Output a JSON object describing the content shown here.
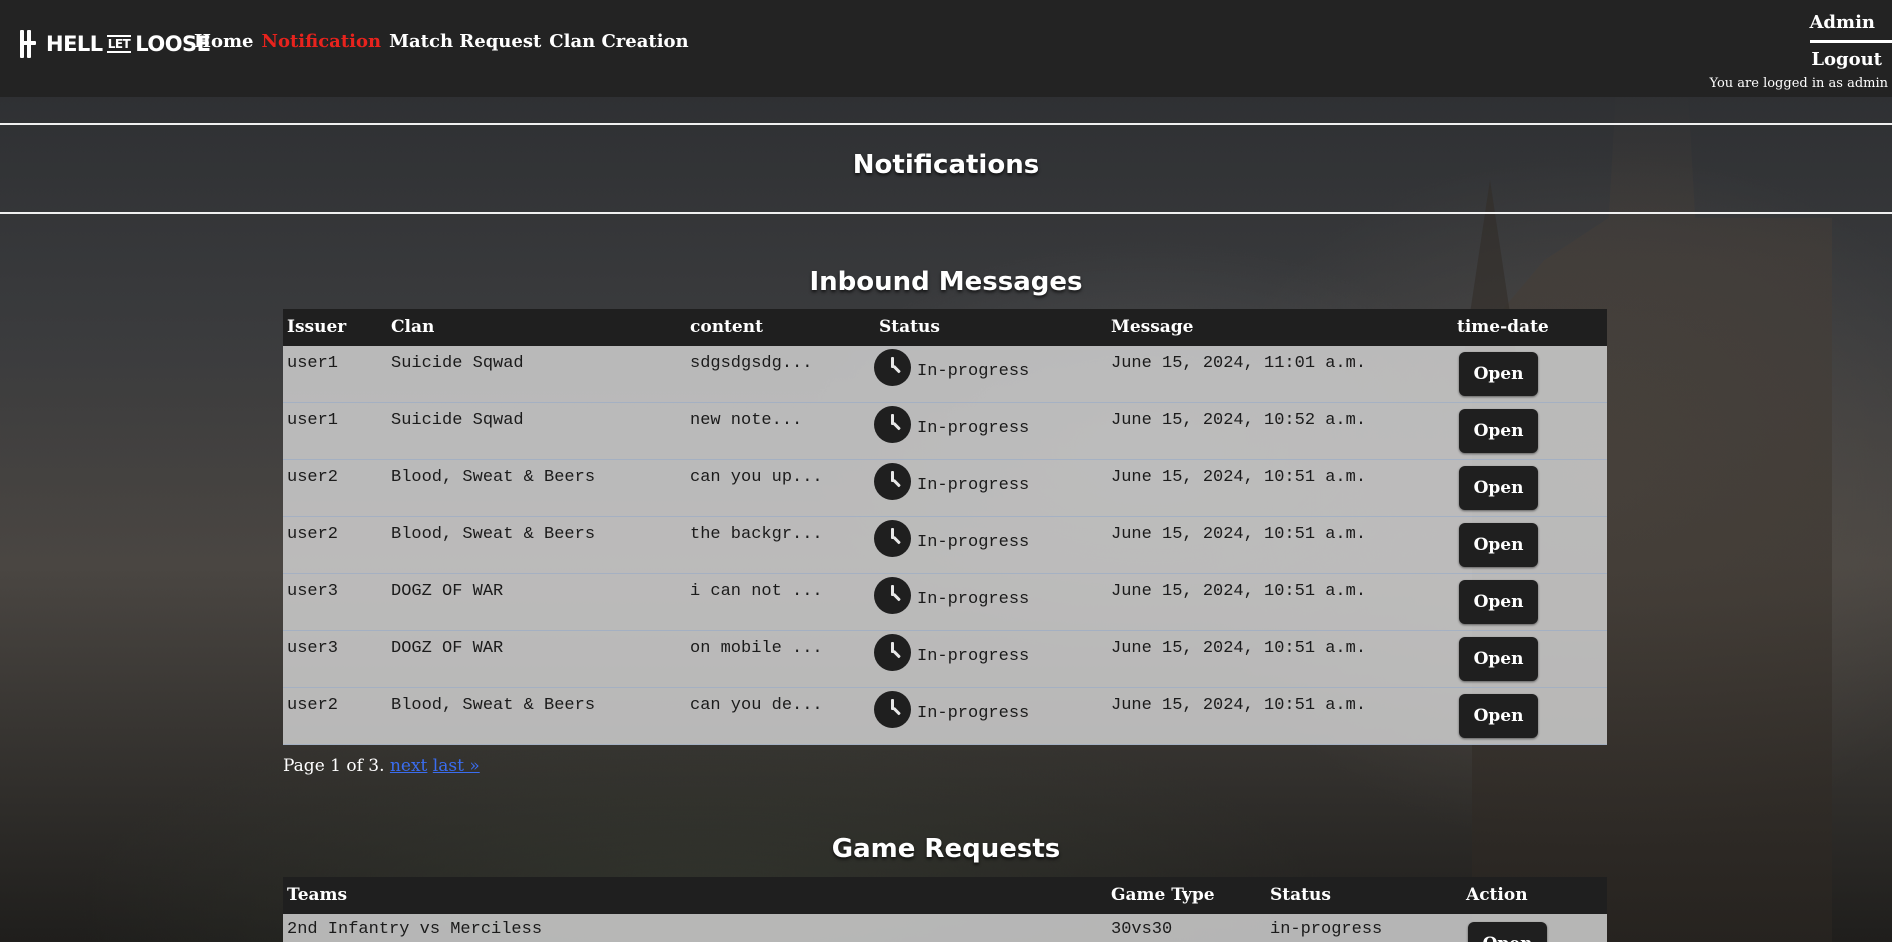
{
  "nav": {
    "brand_left": "HELL",
    "brand_mid": "LET",
    "brand_right": "LOOSE",
    "links": [
      "Home",
      "Notification",
      "Match Request",
      "Clan Creation"
    ],
    "active": "Notification",
    "admin": "Admin",
    "logout": "Logout",
    "logged_in_text": "You are logged in as admin"
  },
  "page_title": "Notifications",
  "inbound": {
    "title": "Inbound Messages",
    "columns": [
      "Issuer",
      "Clan",
      "content",
      "Status",
      "Message",
      "time-date"
    ],
    "rows": [
      {
        "issuer": "user1",
        "clan": "Suicide Sqwad",
        "content": "sdgsdgsdg...",
        "status": "In-progress",
        "date": "June 15, 2024, 11:01 a.m.",
        "action": "Open"
      },
      {
        "issuer": "user1",
        "clan": "Suicide Sqwad",
        "content": "new note...",
        "status": "In-progress",
        "date": "June 15, 2024, 10:52 a.m.",
        "action": "Open"
      },
      {
        "issuer": "user2",
        "clan": "Blood, Sweat & Beers",
        "content": "can you up...",
        "status": "In-progress",
        "date": "June 15, 2024, 10:51 a.m.",
        "action": "Open"
      },
      {
        "issuer": "user2",
        "clan": "Blood, Sweat & Beers",
        "content": "the backgr...",
        "status": "In-progress",
        "date": "June 15, 2024, 10:51 a.m.",
        "action": "Open"
      },
      {
        "issuer": "user3",
        "clan": "DOGZ OF WAR",
        "content": "i can not ...",
        "status": "In-progress",
        "date": "June 15, 2024, 10:51 a.m.",
        "action": "Open"
      },
      {
        "issuer": "user3",
        "clan": "DOGZ OF WAR",
        "content": "on mobile ...",
        "status": "In-progress",
        "date": "June 15, 2024, 10:51 a.m.",
        "action": "Open"
      },
      {
        "issuer": "user2",
        "clan": "Blood, Sweat & Beers",
        "content": "can you de...",
        "status": "In-progress",
        "date": "June 15, 2024, 10:51 a.m.",
        "action": "Open"
      }
    ],
    "pager": {
      "text": "Page 1 of 3.",
      "next": "next",
      "last": "last »"
    }
  },
  "game_requests": {
    "title": "Game Requests",
    "columns": [
      "Teams",
      "Game Type",
      "Status",
      "Action"
    ],
    "rows": [
      {
        "teams": "2nd Infantry vs Merciless",
        "game_type": "30vs30",
        "status": "in-progress",
        "action": "Open"
      }
    ]
  },
  "colors": {
    "accent": "#e8231d",
    "navbar": "#232323",
    "header_row": "#1f1f1f",
    "link": "#3a6df0"
  }
}
